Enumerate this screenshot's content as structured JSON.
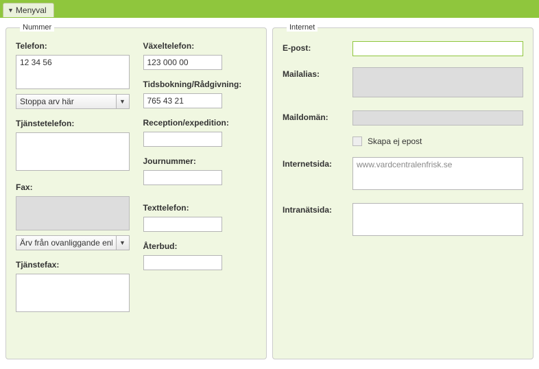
{
  "tab": {
    "label": "Menyval"
  },
  "nummer": {
    "legend": "Nummer",
    "telefon_label": "Telefon:",
    "telefon_value": "12 34 56",
    "telefon_select": "Stoppa arv här",
    "tjanstetelefon_label": "Tjänstetelefon:",
    "tjanstetelefon_value": "",
    "fax_label": "Fax:",
    "fax_value": "",
    "fax_select": "Ärv från ovanliggande enhet",
    "tjanstefax_label": "Tjänstefax:",
    "tjanstefax_value": "",
    "vaxeltelefon_label": "Växeltelefon:",
    "vaxeltelefon_value": "123 000 00",
    "tidsbokning_label": "Tidsbokning/Rådgivning:",
    "tidsbokning_value": "765 43 21",
    "reception_label": "Reception/expedition:",
    "reception_value": "",
    "journummer_label": "Journummer:",
    "journummer_value": "",
    "texttelefon_label": "Texttelefon:",
    "texttelefon_value": "",
    "aterbud_label": "Återbud:",
    "aterbud_value": ""
  },
  "internet": {
    "legend": "Internet",
    "epost_label": "E-post:",
    "epost_value": "",
    "mailalias_label": "Mailalias:",
    "mailalias_value": "",
    "maildoman_label": "Maildomän:",
    "maildoman_value": "",
    "skapa_ej_epost_label": "Skapa ej epost",
    "internetsida_label": "Internetsida:",
    "internetsida_value": "www.vardcentralenfrisk.se",
    "intranatsida_label": "Intranätsida:",
    "intranatsida_value": ""
  }
}
